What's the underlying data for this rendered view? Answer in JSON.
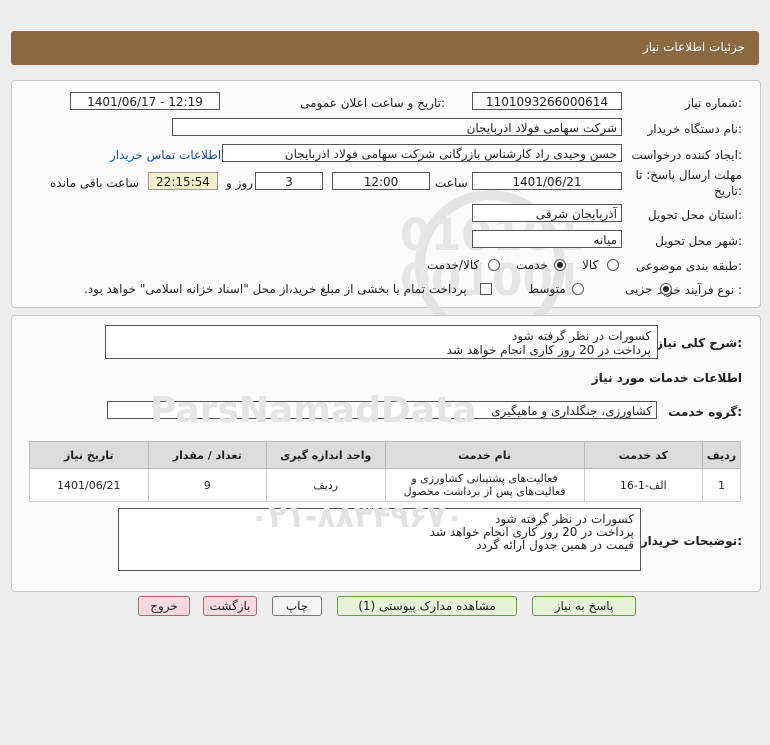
{
  "header": {
    "title": "جزئیات اطلاعات نیاز"
  },
  "form": {
    "need_number_label": "شماره نیاز:",
    "need_number": "1101093266000614",
    "announce_label": "تاریخ و ساعت اعلان عمومی:",
    "announce_value": "1401/06/17 - 12:19",
    "buyer_label": "نام دستگاه خریدار:",
    "buyer_value": "شرکت سهامی فولاد اذربایجان",
    "creator_label": "ایجاد کننده درخواست:",
    "creator_value": "حسن وحیدی راد کارشناس بازرگانی شرکت سهامی فولاد اذربایجان",
    "contact_link": "اطلاعات تماس خریدار",
    "deadline_label_1": "مهلت ارسال پاسخ: تا",
    "deadline_label_2": "تاریخ:",
    "deadline_date": "1401/06/21",
    "time_label": "ساعت",
    "deadline_time": "12:00",
    "days_value": "3",
    "days_label": "روز و",
    "remaining_time": "22:15:54",
    "remaining_label": "ساعت باقی مانده",
    "province_label": "استان محل تحویل:",
    "province_value": "آذربایجان شرقی",
    "city_label": "شهر محل تحویل:",
    "city_value": "میانه",
    "category_label": "طبقه بندی موضوعی:",
    "category_options": [
      "کالا",
      "خدمت",
      "کالا/خدمت"
    ],
    "category_selected": "خدمت",
    "process_label": "نوع فرآیند خرید :",
    "process_options": [
      "جزیی",
      "متوسط"
    ],
    "process_selected": "جزیی",
    "payment_note": "پرداخت تمام یا بخشی از مبلغ خرید،از محل \"اسناد خزانه اسلامی\" خواهد بود."
  },
  "summary": {
    "label": "شرح کلی نیاز:",
    "line1": "کسورات در نظر گرفته شود",
    "line2": "پرداخت در 20 روز کاری انجام خواهد شد"
  },
  "services": {
    "title": "اطلاعات خدمات مورد نیاز",
    "group_label": "گروه خدمت:",
    "group_value": "کشاورزی، جنگلداری و ماهیگیری"
  },
  "table": {
    "headers": [
      "ردیف",
      "کد خدمت",
      "نام خدمت",
      "واحد اندازه گیری",
      "تعداد / مقدار",
      "تاریخ نیاز"
    ],
    "rows": [
      {
        "row": "1",
        "code": "الف-1-16",
        "name": "فعالیت‌های پشتیبانی کشاورزی و فعالیت‌های پس از برداشت محصول",
        "unit": "ردیف",
        "qty": "9",
        "date": "1401/06/21"
      }
    ]
  },
  "buyer_notes": {
    "label": "توضیحات خریدار:",
    "line1": "کسورات در نظر گرفته شود",
    "line2": "پرداخت در 20 روز کاری انجام خواهد شد",
    "line3": "قیمت در همین جدول ارائه گردد"
  },
  "buttons": {
    "reply": "پاسخ به نیاز",
    "attachments": "مشاهده مدارک پیوستی (1)",
    "print": "چاپ",
    "back": "بازگشت",
    "exit": "خروج"
  },
  "colors": {
    "header_bg": "#8b6a43",
    "link": "#1a4fa8"
  }
}
